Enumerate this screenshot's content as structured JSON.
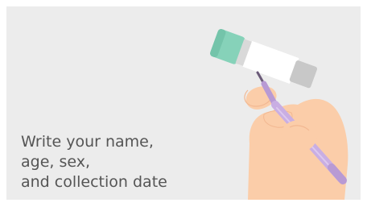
{
  "instruction": {
    "lines": [
      "Write your name,",
      "age, sex,",
      "and collection date"
    ]
  },
  "illustration": {
    "subject": "hand-writing-on-tube-label",
    "icons": [
      "sample-tube-icon",
      "pen-icon",
      "hand-icon"
    ]
  },
  "colors": {
    "background": "#ececec",
    "text": "#555555",
    "tube_cap": "#86d2b9",
    "tube_label": "#ffffff",
    "tube_end": "#c8c8c8",
    "pen": "#c9aee3",
    "skin": "#fbcda9"
  }
}
